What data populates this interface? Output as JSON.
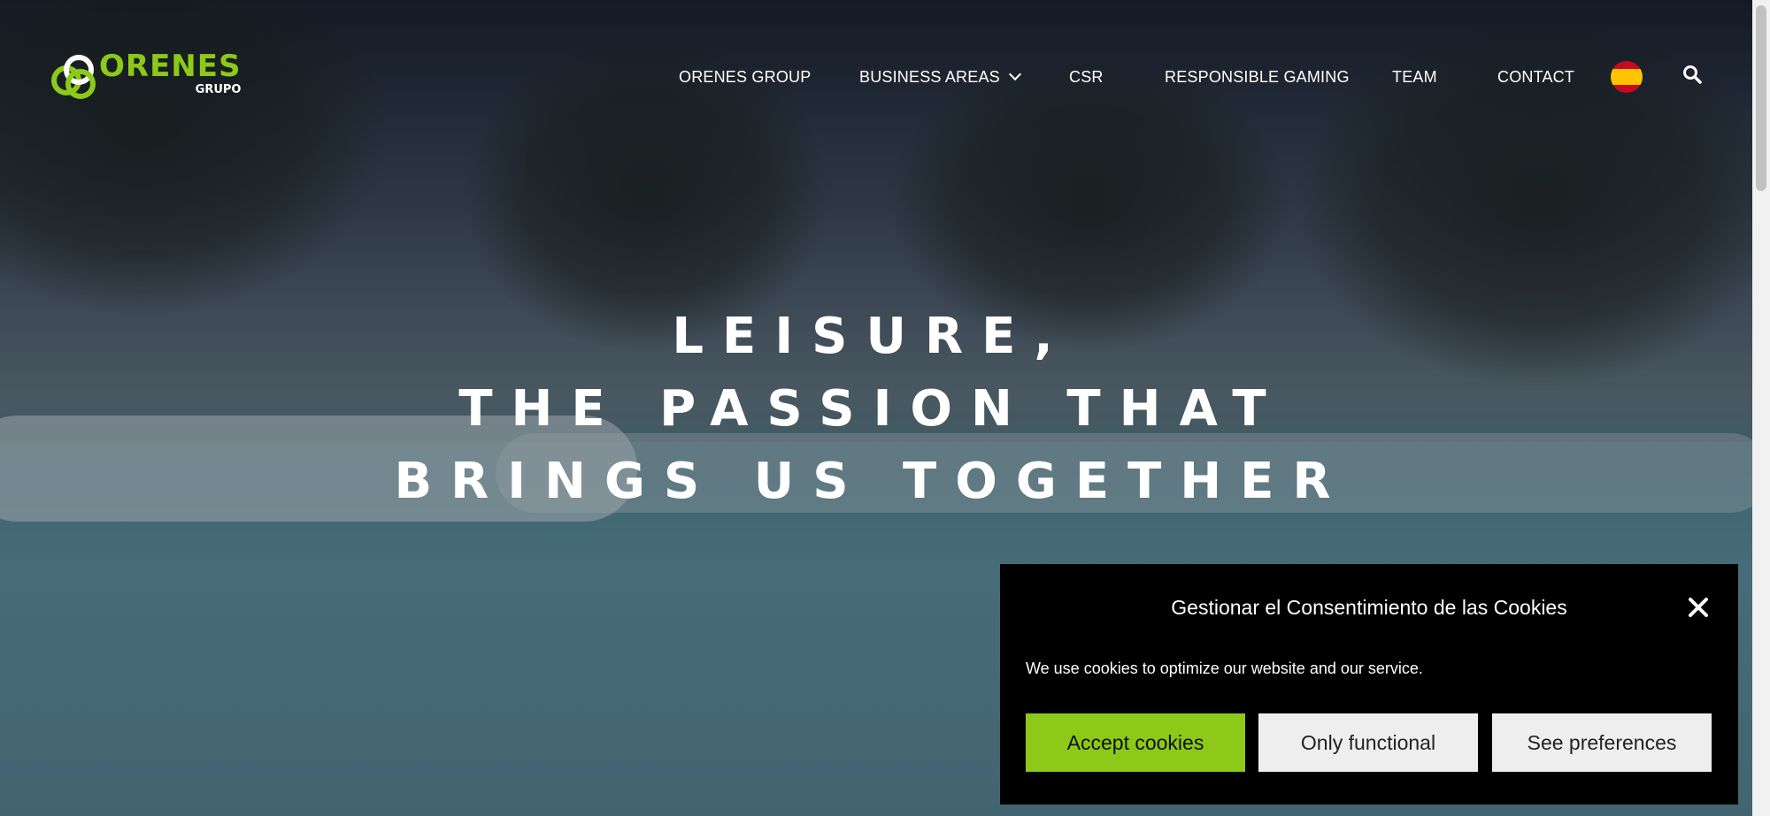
{
  "brand": {
    "name": "ORENES",
    "sub": "GRUPO",
    "accent_color": "#8cc919"
  },
  "nav": {
    "items": [
      {
        "label": "ORENES GROUP"
      },
      {
        "label": "BUSINESS AREAS",
        "has_dropdown": true
      },
      {
        "label": "CSR"
      },
      {
        "label": "RESPONSIBLE GAMING"
      },
      {
        "label": "TEAM"
      },
      {
        "label": "CONTACT"
      }
    ],
    "language_icon": "spain-flag-icon",
    "search_icon": "search-icon"
  },
  "hero": {
    "line1": "LEISURE,",
    "line2": "THE PASSION THAT",
    "line3": "BRINGS US TOGETHER"
  },
  "cookie_banner": {
    "title": "Gestionar el Consentimiento de las Cookies",
    "text": "We use cookies to optimize our website and our service.",
    "accept_label": "Accept cookies",
    "functional_label": "Only functional",
    "preferences_label": "See preferences",
    "close_icon": "close-icon"
  }
}
